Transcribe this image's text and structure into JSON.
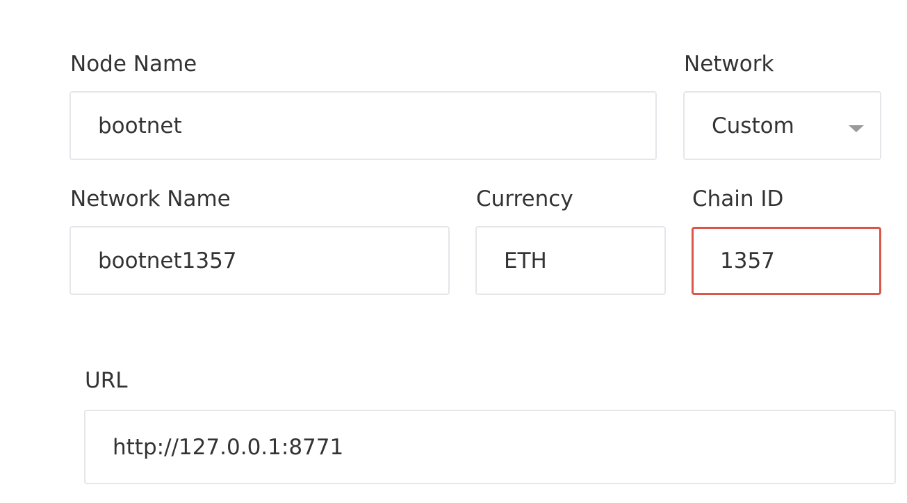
{
  "form": {
    "node_name": {
      "label": "Node Name",
      "value": "bootnet"
    },
    "network": {
      "label": "Network",
      "selected": "Custom"
    },
    "network_name": {
      "label": "Network Name",
      "value": "bootnet1357"
    },
    "currency": {
      "label": "Currency",
      "value": "ETH"
    },
    "chain_id": {
      "label": "Chain ID",
      "value": "1357",
      "border_color": "#d9574a"
    },
    "url": {
      "label": "URL",
      "value": "http://127.0.0.1:8771"
    }
  },
  "icons": {
    "network_select_caret": "chevron-down-icon"
  }
}
